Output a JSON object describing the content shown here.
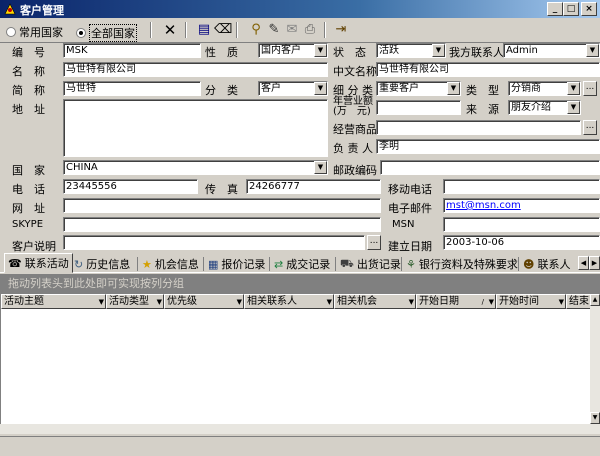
{
  "window": {
    "title": "客户管理"
  },
  "toolbar": {
    "radio_common": "常用国家",
    "radio_all": "全部国家"
  },
  "form": {
    "code": {
      "label": "编　号",
      "value": "MSK"
    },
    "nature": {
      "label": "性　质",
      "value": "国内客户"
    },
    "status": {
      "label": "状　态",
      "value": "活跃"
    },
    "my_contact": {
      "label": "我方联系人",
      "value": "Admin"
    },
    "name": {
      "label": "名　称",
      "value": "马世特有限公司"
    },
    "cn_name": {
      "label": "中文名称",
      "value": "马世特有限公司"
    },
    "short": {
      "label": "简　称",
      "value": "马世特"
    },
    "category": {
      "label": "分　类",
      "value": "客户"
    },
    "sub_category": {
      "label": "细 分 类",
      "value": "重要客户"
    },
    "type": {
      "label": "类　型",
      "value": "分销商"
    },
    "revenue": {
      "label1": "年营业额",
      "label2": "(万　元)",
      "value": ""
    },
    "source": {
      "label": "来　源",
      "value": "朋友介绍"
    },
    "address": {
      "label": "地　址",
      "value": ""
    },
    "products": {
      "label": "经营商品",
      "value": ""
    },
    "owner": {
      "label": "负 责 人",
      "value": "李明"
    },
    "country": {
      "label": "国　家",
      "value": "CHINA"
    },
    "postcode": {
      "label": "邮政编码",
      "value": ""
    },
    "phone": {
      "label": "电　话",
      "value": "23445556"
    },
    "fax": {
      "label": "传　真",
      "value": "24266777"
    },
    "mobile": {
      "label": "移动电话",
      "value": ""
    },
    "website": {
      "label": "网　址",
      "value": ""
    },
    "email": {
      "label": "电子邮件",
      "value": "mst@msn.com"
    },
    "skype": {
      "label": "SKYPE",
      "value": ""
    },
    "msn": {
      "label": "MSN",
      "value": ""
    },
    "desc": {
      "label": "客户说明",
      "value": ""
    },
    "created": {
      "label": "建立日期",
      "value": "2003-10-06"
    }
  },
  "tabs": [
    "联系活动",
    "历史信息",
    "机会信息",
    "报价记录",
    "成交记录",
    "出货记录",
    "银行资料及特殊要求",
    "联系人"
  ],
  "grid": {
    "group_hint": "拖动列表头到此处即可实现按列分组",
    "columns": [
      "活动主题",
      "活动类型",
      "优先级",
      "相关联系人",
      "相关机会",
      "开始日期",
      "开始时间",
      "结束日期"
    ]
  }
}
